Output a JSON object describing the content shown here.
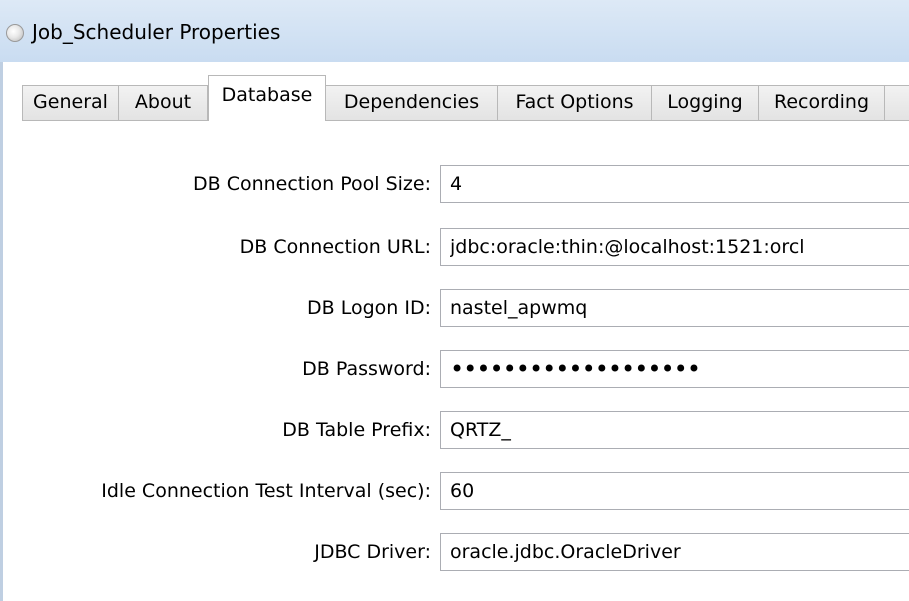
{
  "window": {
    "title": "Job_Scheduler Properties",
    "icon": "app-icon"
  },
  "tabs": [
    {
      "label": "General",
      "active": false
    },
    {
      "label": "About",
      "active": false
    },
    {
      "label": "Database",
      "active": true
    },
    {
      "label": "Dependencies",
      "active": false
    },
    {
      "label": "Fact Options",
      "active": false
    },
    {
      "label": "Logging",
      "active": false
    },
    {
      "label": "Recording",
      "active": false
    },
    {
      "label": "",
      "active": false
    }
  ],
  "fields": {
    "pool_size": {
      "label": "DB Connection Pool Size:",
      "value": "4"
    },
    "url": {
      "label": "DB Connection URL:",
      "value": "jdbc:oracle:thin:@localhost:1521:orcl"
    },
    "logon_id": {
      "label": "DB Logon ID:",
      "value": "nastel_apwmq"
    },
    "password": {
      "label": "DB Password:",
      "value": "•••••••••••••••••••"
    },
    "table_prefix": {
      "label": "DB Table Prefix:",
      "value": "QRTZ_"
    },
    "idle_interval": {
      "label": "Idle Connection Test Interval (sec):",
      "value": "60"
    },
    "jdbc_driver": {
      "label": "JDBC Driver:",
      "value": "oracle.jdbc.OracleDriver"
    }
  }
}
